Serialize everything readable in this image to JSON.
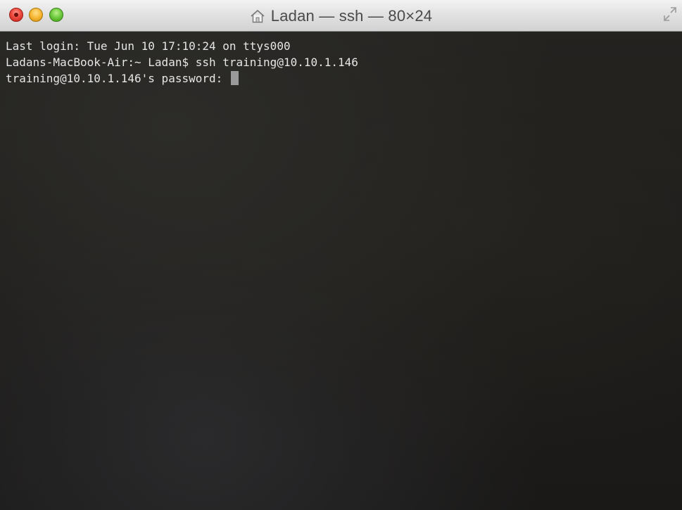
{
  "window": {
    "title": "Ladan — ssh — 80×24"
  },
  "terminal": {
    "lines": [
      "Last login: Tue Jun 10 17:10:24 on ttys000",
      "Ladans-MacBook-Air:~ Ladan$ ssh training@10.10.1.146",
      "training@10.10.1.146's password: "
    ]
  },
  "icons": {
    "close": "close-icon",
    "minimize": "minimize-icon",
    "zoom": "zoom-icon",
    "home": "home-icon",
    "fullscreen": "fullscreen-icon"
  },
  "colors": {
    "terminal_background": "#1d1b19",
    "terminal_text": "#e6e6e6",
    "cursor": "#9a9a9a",
    "close_button": "#ee4b3f",
    "minimize_button": "#f7b733",
    "zoom_button": "#6cc83b"
  }
}
